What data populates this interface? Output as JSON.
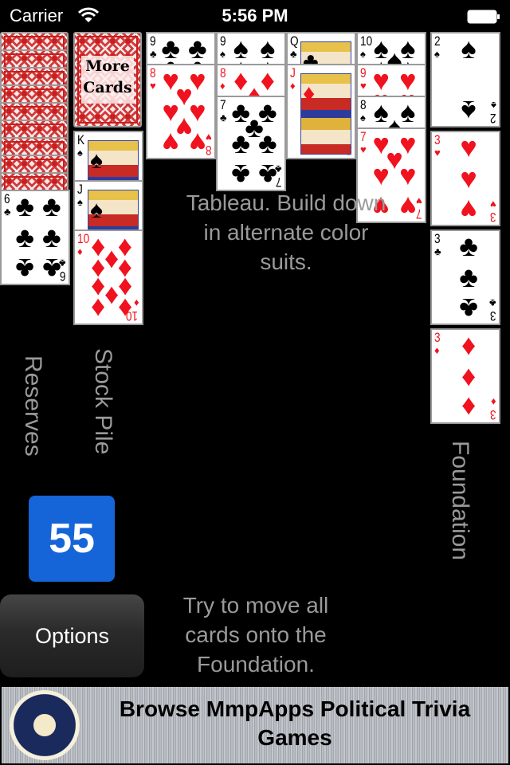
{
  "status_bar": {
    "carrier": "Carrier",
    "time": "5:56 PM",
    "wifi_icon": "wifi-icon",
    "battery_icon": "battery-icon"
  },
  "reserves": {
    "label": "Reserves",
    "face_down_count": 9,
    "top_card": {
      "rank": "6",
      "suit": "♣",
      "color": "black"
    }
  },
  "stock_pile": {
    "label": "Stock Pile",
    "more_cards_label_line1": "More",
    "more_cards_label_line2": "Cards",
    "cards": [
      {
        "rank": "K",
        "suit": "♠",
        "color": "black"
      },
      {
        "rank": "J",
        "suit": "♠",
        "color": "black"
      },
      {
        "rank": "10",
        "suit": "♦",
        "color": "red"
      }
    ]
  },
  "tableau": {
    "hint": "Tableau. Build down in alternate color suits.",
    "columns": [
      [
        {
          "rank": "9",
          "suit": "♣",
          "color": "black"
        },
        {
          "rank": "8",
          "suit": "♥",
          "color": "red"
        }
      ],
      [
        {
          "rank": "9",
          "suit": "♠",
          "color": "black"
        },
        {
          "rank": "8",
          "suit": "♦",
          "color": "red"
        },
        {
          "rank": "7",
          "suit": "♣",
          "color": "black"
        }
      ],
      [
        {
          "rank": "Q",
          "suit": "♣",
          "color": "black"
        },
        {
          "rank": "J",
          "suit": "♦",
          "color": "red"
        }
      ],
      [
        {
          "rank": "10",
          "suit": "♠",
          "color": "black"
        },
        {
          "rank": "9",
          "suit": "♥",
          "color": "red"
        },
        {
          "rank": "8",
          "suit": "♠",
          "color": "black"
        },
        {
          "rank": "7",
          "suit": "♥",
          "color": "red"
        }
      ]
    ]
  },
  "foundation": {
    "label": "Foundation",
    "cards": [
      {
        "rank": "2",
        "suit": "♠",
        "color": "black"
      },
      {
        "rank": "3",
        "suit": "♥",
        "color": "red"
      },
      {
        "rank": "3",
        "suit": "♣",
        "color": "black"
      },
      {
        "rank": "3",
        "suit": "♦",
        "color": "red"
      }
    ]
  },
  "score": "55",
  "options_label": "Options",
  "goal_hint": "Try to move all cards onto the Foundation.",
  "banner": {
    "text": "Browse MmpApps Political Trivia Games",
    "seal_icon": "presidential-seal-icon"
  },
  "colors": {
    "score_bg": "#1565d8",
    "red_suit": "#f0121e",
    "label_gray": "#9a9a9a"
  }
}
